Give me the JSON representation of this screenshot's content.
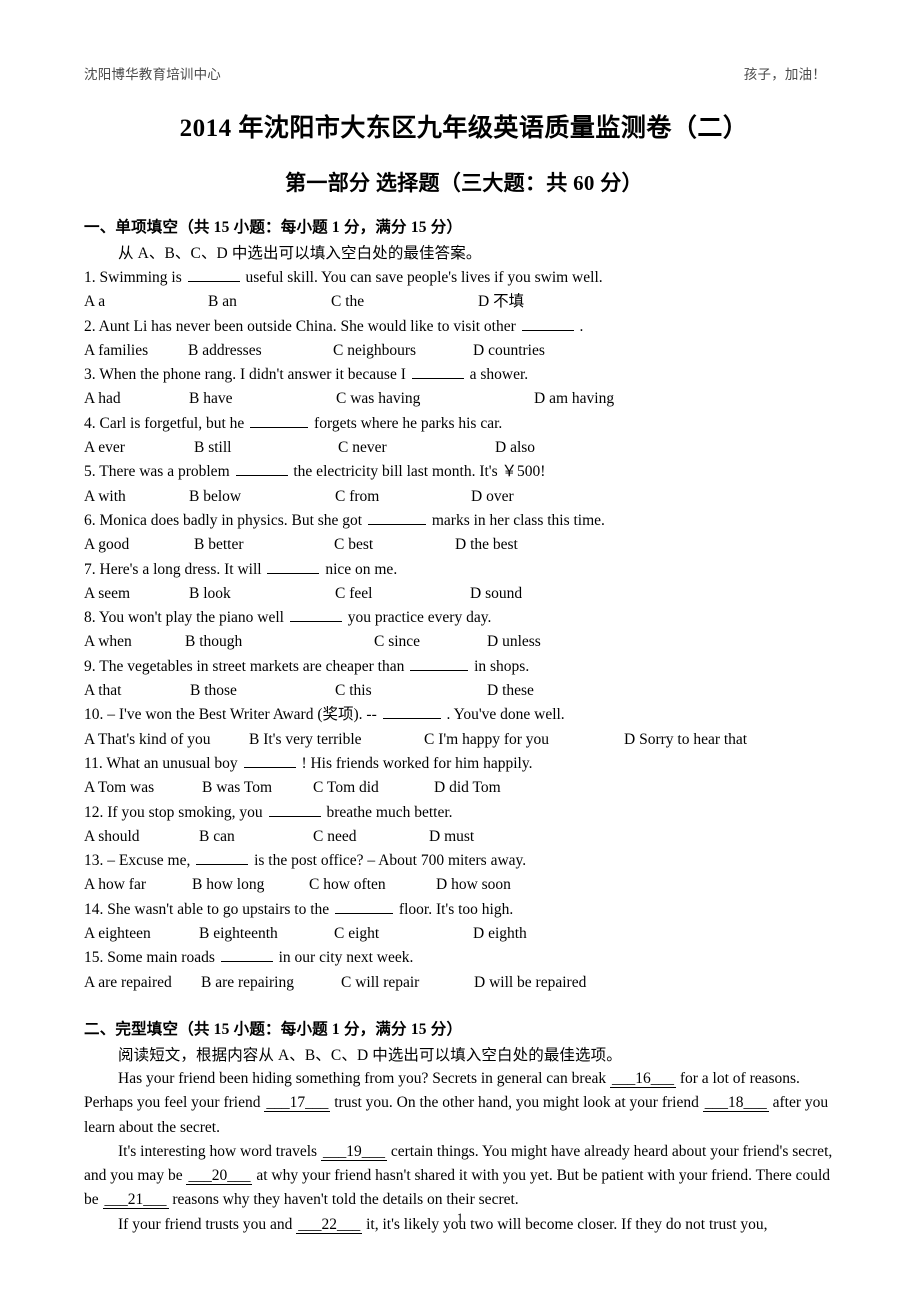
{
  "header": {
    "left": "沈阳博华教育培训中心",
    "right": "孩子，加油！"
  },
  "title": "2014 年沈阳市大东区九年级英语质量监测卷（二）",
  "part_title": "第一部分 选择题（三大题：共 60 分）",
  "section1": {
    "heading": "一、单项填空（共 15 小题：每小题 1 分，满分 15 分）",
    "instruction": "从 A、B、C、D 中选出可以填入空白处的最佳答案。",
    "questions": [
      {
        "stem_before": "1. Swimming is",
        "stem_after": "useful skill. You can save people's lives if you swim well.",
        "options": [
          "A a",
          "B an",
          "C the",
          "D 不填"
        ],
        "cols": [
          0,
          124,
          247,
          394
        ]
      },
      {
        "stem_before": "2. Aunt Li has never been outside China. She would like to visit other",
        "stem_after": ".",
        "options": [
          "A families",
          "B addresses",
          "C neighbours",
          "D countries"
        ],
        "cols": [
          0,
          104,
          249,
          389
        ]
      },
      {
        "stem_before": "3. When the phone rang. I didn't answer it because I",
        "stem_after": "a shower.",
        "options": [
          "A had",
          "B have",
          "C was having",
          "D am having"
        ],
        "cols": [
          0,
          105,
          252,
          450
        ]
      },
      {
        "stem_before": "4. Carl is forgetful, but he",
        "stem_after": "forgets where he parks his car.",
        "options": [
          "A ever",
          "B still",
          "C never",
          "D also"
        ],
        "cols": [
          0,
          110,
          254,
          411
        ]
      },
      {
        "stem_before": "5. There was a problem",
        "stem_after": "the electricity bill last month. It's ￥500!",
        "options": [
          "A with",
          "B below",
          "C from",
          "D over"
        ],
        "cols": [
          0,
          105,
          251,
          387
        ]
      },
      {
        "stem_before": "6. Monica does badly in physics. But she got",
        "stem_after": "marks in her class this time.",
        "options": [
          "A good",
          "B better",
          "C best",
          "D the best"
        ],
        "cols": [
          0,
          110,
          250,
          371
        ]
      },
      {
        "stem_before": "7. Here's a long dress. It will",
        "stem_after": "nice on me.",
        "options": [
          "A seem",
          "B look",
          "C feel",
          "D sound"
        ],
        "cols": [
          0,
          105,
          251,
          386
        ]
      },
      {
        "stem_before": "8. You won't play the piano well",
        "stem_after": "you practice every day.",
        "options": [
          "A when",
          "B though",
          "C since",
          "D unless"
        ],
        "cols": [
          0,
          101,
          290,
          403
        ]
      },
      {
        "stem_before": "9. The vegetables in street markets are cheaper than",
        "stem_after": "in shops.",
        "options": [
          "A that",
          "B those",
          "C this",
          "D these"
        ],
        "cols": [
          0,
          106,
          251,
          403
        ]
      },
      {
        "stem_before": "10. – I've won the Best Writer Award (奖项).   --",
        "stem_after": ". You've done well.",
        "options": [
          "A That's kind of you",
          "B It's very terrible",
          "C I'm happy for you",
          "D Sorry to hear that"
        ],
        "cols": [
          0,
          165,
          340,
          540
        ]
      },
      {
        "stem_before": "11. What an unusual boy",
        "stem_after": "! His friends worked for him happily.",
        "options": [
          "A Tom was",
          "B was Tom",
          "C Tom did",
          "D did Tom"
        ],
        "cols": [
          0,
          118,
          229,
          350
        ]
      },
      {
        "stem_before": "12. If you stop smoking, you",
        "stem_after": "breathe much better.",
        "options": [
          "A should",
          "B can",
          "C need",
          "D must"
        ],
        "cols": [
          0,
          115,
          229,
          345
        ]
      },
      {
        "stem_before": "13. – Excuse me,",
        "stem_after": "is the post office?   – About 700 miters away.",
        "options": [
          "A how far",
          "B how long",
          "C how often",
          "D how soon"
        ],
        "cols": [
          0,
          108,
          225,
          352
        ]
      },
      {
        "stem_before": "14. She wasn't able to go upstairs to the",
        "stem_after": "floor. It's too high.",
        "options": [
          "A eighteen",
          "B eighteenth",
          "C eight",
          "D eighth"
        ],
        "cols": [
          0,
          115,
          250,
          389
        ]
      },
      {
        "stem_before": "15. Some main roads",
        "stem_after": "in our city next week.",
        "options": [
          "A are repaired",
          "B are repairing",
          "C will repair",
          "D will be repaired"
        ],
        "cols": [
          0,
          117,
          257,
          390
        ]
      }
    ]
  },
  "section2": {
    "heading": "二、完型填空（共 15 小题：每小题 1 分，满分 15 分）",
    "instruction": "阅读短文，根据内容从 A、B、C、D 中选出可以填入空白处的最佳选项。",
    "paragraphs": [
      {
        "indent": true,
        "parts": [
          {
            "type": "text",
            "value": "Has your friend been hiding something from you? Secrets in general can break "
          },
          {
            "type": "blank",
            "value": "16"
          },
          {
            "type": "text",
            "value": " for a lot of reasons. Perhaps you feel your friend "
          },
          {
            "type": "blank",
            "value": "17"
          },
          {
            "type": "text",
            "value": " trust you. On the other hand, you might look at your friend "
          },
          {
            "type": "blank",
            "value": "18"
          },
          {
            "type": "text",
            "value": " after you learn about the secret."
          }
        ]
      },
      {
        "indent": true,
        "parts": [
          {
            "type": "text",
            "value": "It's interesting how word travels "
          },
          {
            "type": "blank",
            "value": "19"
          },
          {
            "type": "text",
            "value": " certain things. You might have already heard about your friend's secret, and you may be "
          },
          {
            "type": "blank",
            "value": "20"
          },
          {
            "type": "text",
            "value": " at why your friend hasn't shared it with you yet. But be patient with your friend. There could be "
          },
          {
            "type": "blank",
            "value": "21"
          },
          {
            "type": "text",
            "value": " reasons why they haven't told the details on their secret."
          }
        ]
      },
      {
        "indent": true,
        "parts": [
          {
            "type": "text",
            "value": "If your friend trusts you and "
          },
          {
            "type": "blank",
            "value": "22"
          },
          {
            "type": "text",
            "value": " it, it's likely you two will become closer. If they do not trust you,"
          }
        ]
      }
    ]
  },
  "page_number": "1"
}
